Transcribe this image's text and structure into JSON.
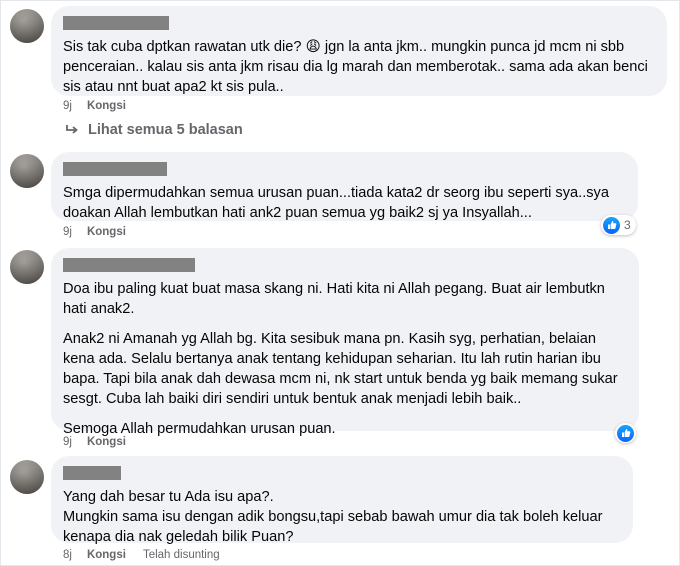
{
  "comments": [
    {
      "paragraphs": [
        "Sis tak cuba dptkan rawatan utk die? 😩 jgn la anta jkm.. mungkin punca jd mcm ni sbb penceraian.. kalau sis anta jkm risau dia lg marah dan memberotak.. sama ada akan benci sis atau nnt buat apa2 kt sis pula.."
      ],
      "time": "9j",
      "reply_label": "Kongsi"
    },
    {
      "paragraphs": [
        "Smga dipermudahkan semua urusan puan...tiada kata2 dr seorg ibu seperti sya..sya doakan Allah lembutkan hati ank2 puan semua yg baik2 sj ya Insyallah..."
      ],
      "time": "9j",
      "reply_label": "Kongsi",
      "reaction_count": "3"
    },
    {
      "paragraphs": [
        "Doa ibu paling kuat buat masa skang ni. Hati kita ni Allah pegang. Buat air lembutkn hati anak2.",
        "Anak2 ni Amanah yg Allah bg. Kita sesibuk mana pn. Kasih syg, perhatian, belaian kena ada. Selalu bertanya anak tentang kehidupan seharian. Itu lah rutin harian ibu bapa. Tapi bila anak dah dewasa mcm ni, nk start untuk benda yg baik memang sukar sesgt. Cuba lah baiki diri sendiri untuk bentuk anak menjadi lebih baik..",
        "Semoga Allah permudahkan urusan puan."
      ],
      "time": "9j",
      "reply_label": "Kongsi"
    },
    {
      "paragraphs": [
        "Yang dah besar tu Ada isu apa?.\nMungkin sama isu dengan adik bongsu,tapi sebab bawah umur dia tak boleh keluar kenapa dia nak geledah bilik Puan?"
      ],
      "time": "8j",
      "reply_label": "Kongsi",
      "edited_label": "Telah disunting"
    }
  ],
  "view_replies": "Lihat semua 5 balasan",
  "colors": {
    "bubble": "#f0f2f5",
    "meta_text": "#65676b",
    "like_blue": "#0866ff",
    "redaction": "#828282"
  },
  "icons": [
    "reply-arrow-icon",
    "like-reaction-icon"
  ]
}
